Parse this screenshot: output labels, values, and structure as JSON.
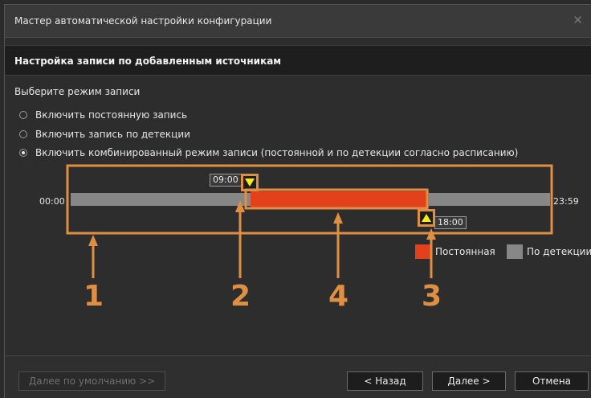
{
  "window": {
    "title": "Мастер автоматической настройки конфигурации"
  },
  "section": {
    "title": "Настройка записи по добавленным источникам"
  },
  "mode": {
    "label": "Выберите режим записи",
    "options": [
      {
        "label": "Включить постоянную запись",
        "checked": false
      },
      {
        "label": "Включить запись по детекции",
        "checked": false
      },
      {
        "label": "Включить комбинированный режим записи (постоянной и по детекции согласно расписанию)",
        "checked": true
      }
    ]
  },
  "timeline": {
    "start": "00:00",
    "end": "23:59",
    "range_start": "09:00",
    "range_end": "18:00"
  },
  "legend": {
    "constant": {
      "label": "Постоянная",
      "color": "#e2411c"
    },
    "detection": {
      "label": "По детекции",
      "color": "#878787"
    }
  },
  "annotations": {
    "n1": "1",
    "n2": "2",
    "n3": "3",
    "n4": "4",
    "color": "#de8f44"
  },
  "footer": {
    "default_label": "Далее по умолчанию >>",
    "back_label": "< Назад",
    "next_label": "Далее >",
    "cancel_label": "Отмена"
  }
}
